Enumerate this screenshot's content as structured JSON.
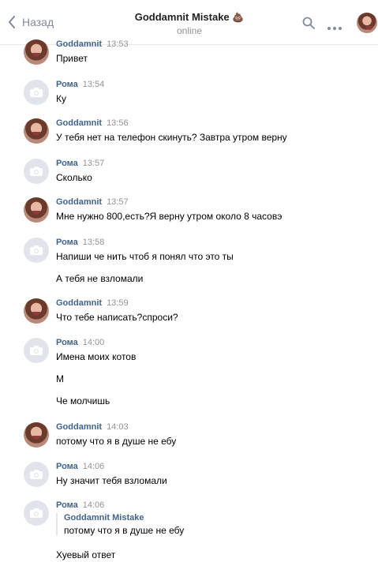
{
  "header": {
    "back_label": "Назад",
    "title": "Goddamnit Mistake",
    "title_emoji": "💩",
    "status": "online"
  },
  "messages": [
    {
      "sender": "Goddamnit",
      "time": "13:53",
      "avatar": "photo",
      "lines": [
        "Привет"
      ]
    },
    {
      "sender": "Рома",
      "time": "13:54",
      "avatar": "camera",
      "lines": [
        "Ку"
      ]
    },
    {
      "sender": "Goddamnit",
      "time": "13:56",
      "avatar": "photo",
      "lines": [
        "У тебя нет на телефон скинуть? Завтра утром верну"
      ]
    },
    {
      "sender": "Рома",
      "time": "13:57",
      "avatar": "camera",
      "lines": [
        "Сколько"
      ]
    },
    {
      "sender": "Goddamnit",
      "time": "13:57",
      "avatar": "photo",
      "lines": [
        "Мне нужно 800,есть?Я верну утром около 8 часовэ"
      ]
    },
    {
      "sender": "Рома",
      "time": "13:58",
      "avatar": "camera",
      "lines": [
        "Напиши че нить чтоб я понял что это ты",
        "А тебя не взломали"
      ]
    },
    {
      "sender": "Goddamnit",
      "time": "13:59",
      "avatar": "photo",
      "lines": [
        "Что тебе написать?спроси?"
      ]
    },
    {
      "sender": "Рома",
      "time": "14:00",
      "avatar": "camera",
      "lines": [
        "Имена моих котов",
        "М",
        "Че молчишь"
      ]
    },
    {
      "sender": "Goddamnit",
      "time": "14:03",
      "avatar": "photo",
      "lines": [
        "потому что я в душе не ебу"
      ]
    },
    {
      "sender": "Рома",
      "time": "14:06",
      "avatar": "camera",
      "lines": [
        "Ну значит тебя взломали"
      ]
    },
    {
      "sender": "Рома",
      "time": "14:06",
      "avatar": "camera",
      "quote": {
        "name": "Goddamnit Mistake",
        "text": "потому что я в душе не ебу"
      },
      "lines": [
        "Хуевый ответ"
      ]
    }
  ]
}
